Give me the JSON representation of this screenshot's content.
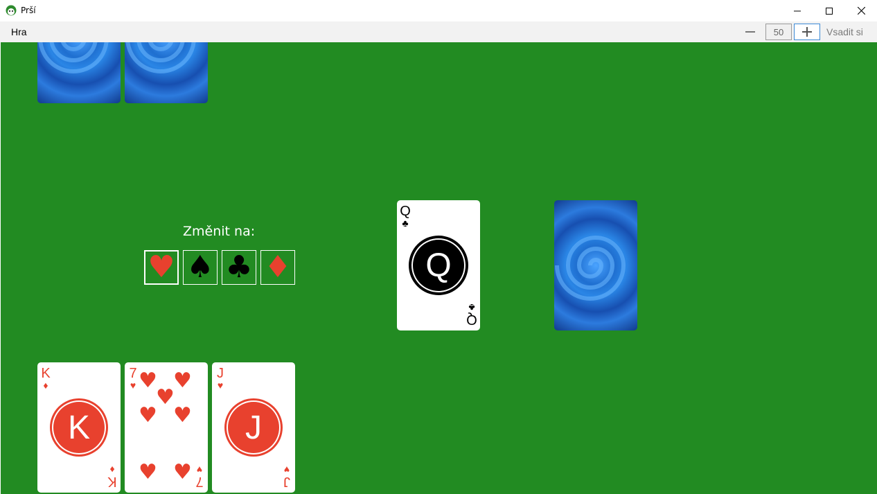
{
  "window": {
    "title": "Prší",
    "controls": [
      "minimize",
      "maximize",
      "close"
    ]
  },
  "menu": {
    "items": [
      "Hra"
    ]
  },
  "bet": {
    "value": "50",
    "decrease_label": "−",
    "increase_label": "+",
    "submit_label": "Vsadit si"
  },
  "colors": {
    "table": "#228b22",
    "red_suit": "#e8412e",
    "black_suit": "#000000",
    "card_back": "#1f6fd0"
  },
  "opponent_hand": {
    "card_count": 2
  },
  "discard_pile": {
    "top_card": {
      "rank": "Q",
      "suit": "♣",
      "suit_name": "clubs",
      "color": "black"
    }
  },
  "draw_pile": {
    "face": "down"
  },
  "suit_change": {
    "label": "Změnit na:",
    "options": [
      {
        "suit": "♥",
        "name": "hearts",
        "selected": true
      },
      {
        "suit": "♠",
        "name": "spades",
        "selected": false
      },
      {
        "suit": "♣",
        "name": "clubs",
        "selected": false
      },
      {
        "suit": "♦",
        "name": "diamonds",
        "selected": false
      }
    ]
  },
  "player_hand": [
    {
      "rank": "K",
      "suit": "♦",
      "suit_name": "diamonds",
      "color": "red"
    },
    {
      "rank": "7",
      "suit": "♥",
      "suit_name": "hearts",
      "color": "red"
    },
    {
      "rank": "J",
      "suit": "♥",
      "suit_name": "hearts",
      "color": "red"
    }
  ]
}
